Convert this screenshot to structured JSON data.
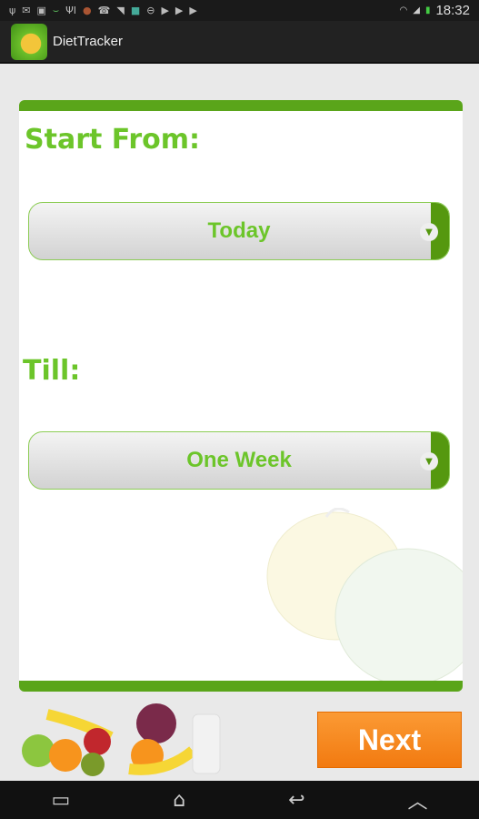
{
  "status_bar": {
    "time": "18:32",
    "icons": [
      "usb-icon",
      "mail-icon",
      "image-icon",
      "plant-icon",
      "fork-icon",
      "fruit-icon",
      "missed-call-icon",
      "send-icon",
      "app-icon",
      "block-icon",
      "play-store-icon",
      "play-store-icon",
      "play-store-icon"
    ]
  },
  "action_bar": {
    "title": "DietTracker"
  },
  "form": {
    "start_label": "Start From:",
    "start_value": "Today",
    "till_label": "Till:",
    "till_value": "One Week"
  },
  "next_label": "Next",
  "colors": {
    "accent": "#6cc52a",
    "header_bar": "#5aa51a",
    "button": "#f58a1f"
  }
}
